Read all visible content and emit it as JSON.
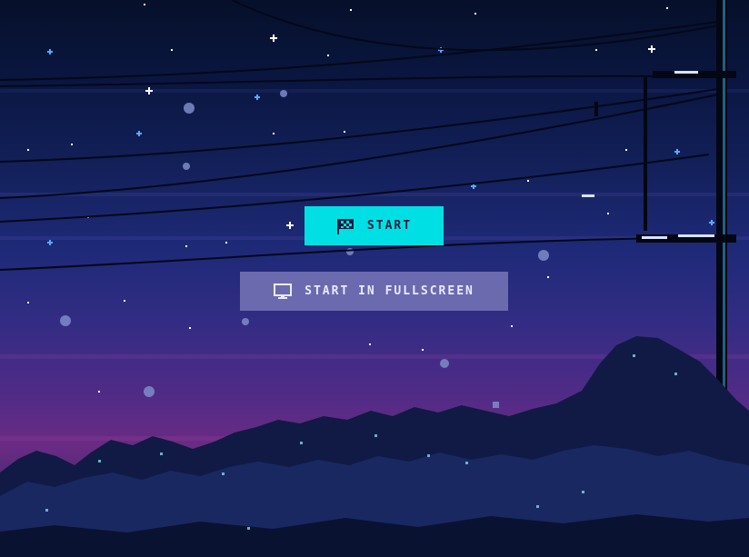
{
  "menu": {
    "start_label": "Start",
    "fullscreen_label": "Start in fullscreen"
  },
  "icons": {
    "start": "checkered-flag-icon",
    "fullscreen": "monitor-icon"
  },
  "colors": {
    "start_button": "#00e0e4",
    "fullscreen_button": "#6b6aaf",
    "sky_top": "#06102a",
    "sky_horizon": "#6a2b84"
  }
}
